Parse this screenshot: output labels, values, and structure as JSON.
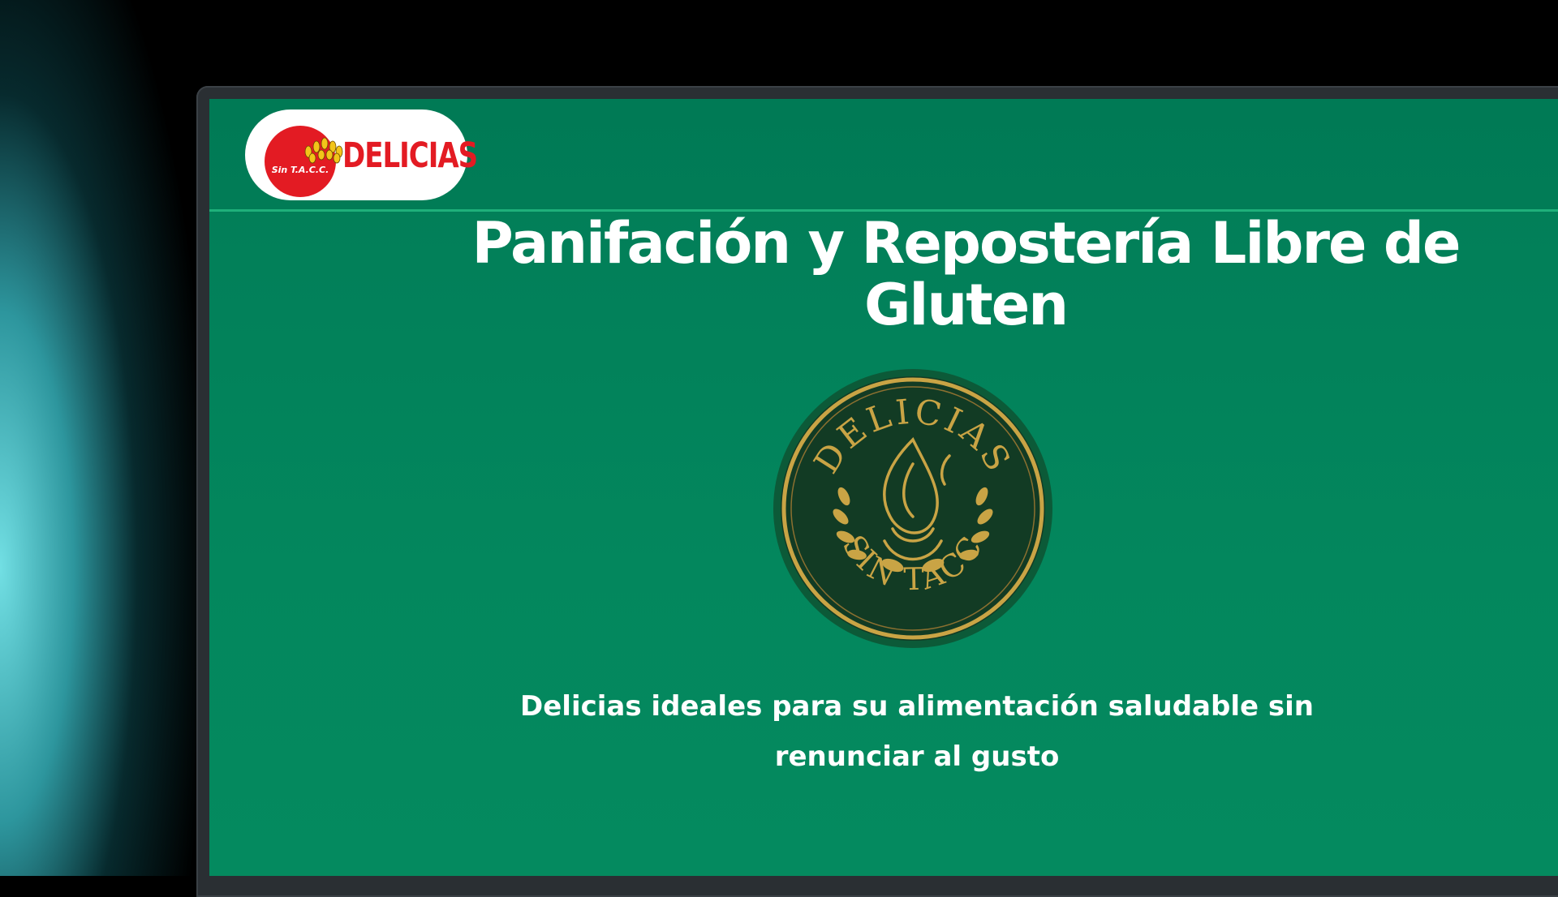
{
  "header": {
    "logo": {
      "badge_text": "Sin T.A.C.C.",
      "brand_name": "DELICIAS",
      "colors": {
        "red": "#e31b23",
        "wheat": "#f3c41a"
      }
    }
  },
  "hero": {
    "title": "Panifación y Repostería Libre de Gluten",
    "seal": {
      "top_text": "DELICIAS",
      "bottom_text": "SIN TACC",
      "colors": {
        "gold": "#c9a445",
        "dark_green": "#133d26"
      }
    },
    "subtitle": "Delicias ideales para su alimentación saludable sin renunciar al gusto"
  },
  "theme": {
    "page_green": "#03875d",
    "nav_border": "#1fb07a"
  }
}
